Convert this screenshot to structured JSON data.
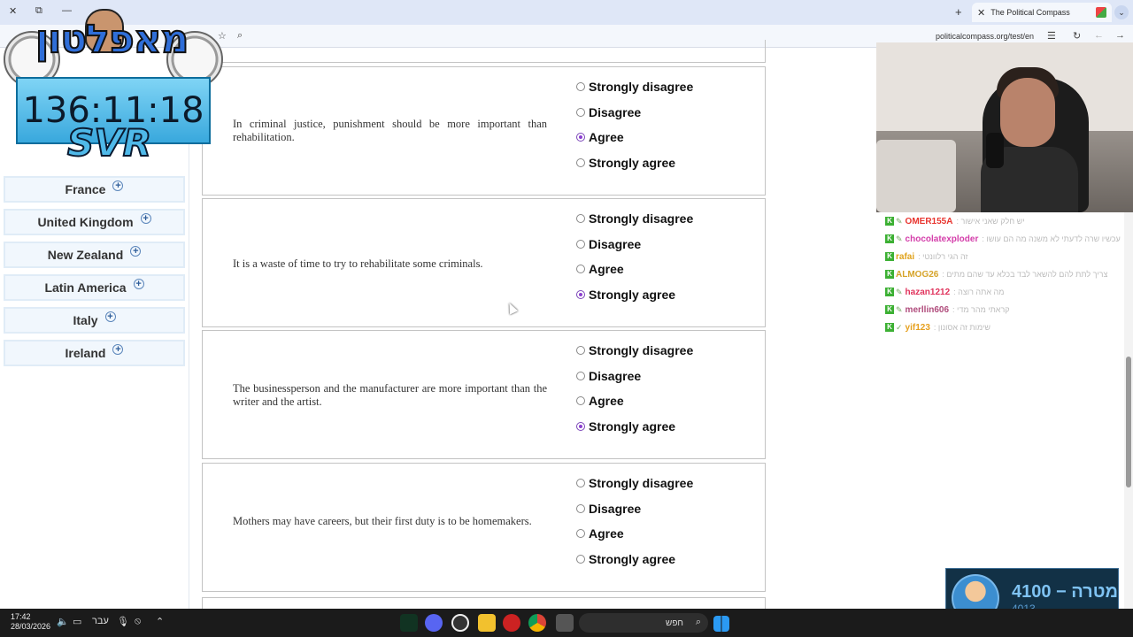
{
  "browser": {
    "tab_title": "The Political Compass",
    "tab_close": "✕",
    "new_tab": "+",
    "url": "politicalcompass.org/test/en"
  },
  "sidebar": {
    "items": [
      {
        "label": "France"
      },
      {
        "label": "United Kingdom"
      },
      {
        "label": "New Zealand"
      },
      {
        "label": "Latin America"
      },
      {
        "label": "Italy"
      },
      {
        "label": "Ireland"
      }
    ]
  },
  "options": [
    "Strongly disagree",
    "Disagree",
    "Agree",
    "Strongly agree"
  ],
  "questions": [
    {
      "text": "In criminal justice, punishment should be more important than rehabilitation.",
      "selected": "Agree"
    },
    {
      "text": "It is a waste of time to try to rehabilitate some criminals.",
      "selected": "Strongly agree"
    },
    {
      "text": "The businessperson and the manufacturer are more important than the writer and the artist.",
      "selected": "Strongly agree"
    },
    {
      "text": "Mothers may have careers, but their first duty is to be homemakers.",
      "selected": null
    }
  ],
  "overlay": {
    "logo": "מאפלטון",
    "timer": "136:11:18",
    "brand": "SVR",
    "goal_main": "4100 − מטרה",
    "goal_sub": "4013"
  },
  "chat": [
    {
      "user": "OMER155A",
      "color": "#e8342e",
      "msg": ": יש חלק שאני אישור"
    },
    {
      "user": "chocolatexploder",
      "color": "#d43eaa",
      "msg": ": עכשיו שרה לדעתי לא משנה מה הם עושו"
    },
    {
      "user": "rafai",
      "color": "#e0a21a",
      "msg": ": זה הגי רלוונטי"
    },
    {
      "user": "ALMOG26",
      "color": "#d6a42a",
      "msg": ": צריך לתת להם להשאר לבד בכלא עד שהם מתים"
    },
    {
      "user": "hazan1212",
      "color": "#e0335c",
      "msg": ": מה אתה רוצה"
    },
    {
      "user": "merllin606",
      "color": "#b04c7c",
      "msg": ": קראתי מהר מדי"
    },
    {
      "user": "yif123",
      "color": "#e6a01e",
      "msg": ": שימות זה אסונון"
    }
  ],
  "taskbar": {
    "time": "17:42",
    "date": "28/03/2026",
    "lang": "עבר",
    "search": "חפש"
  }
}
